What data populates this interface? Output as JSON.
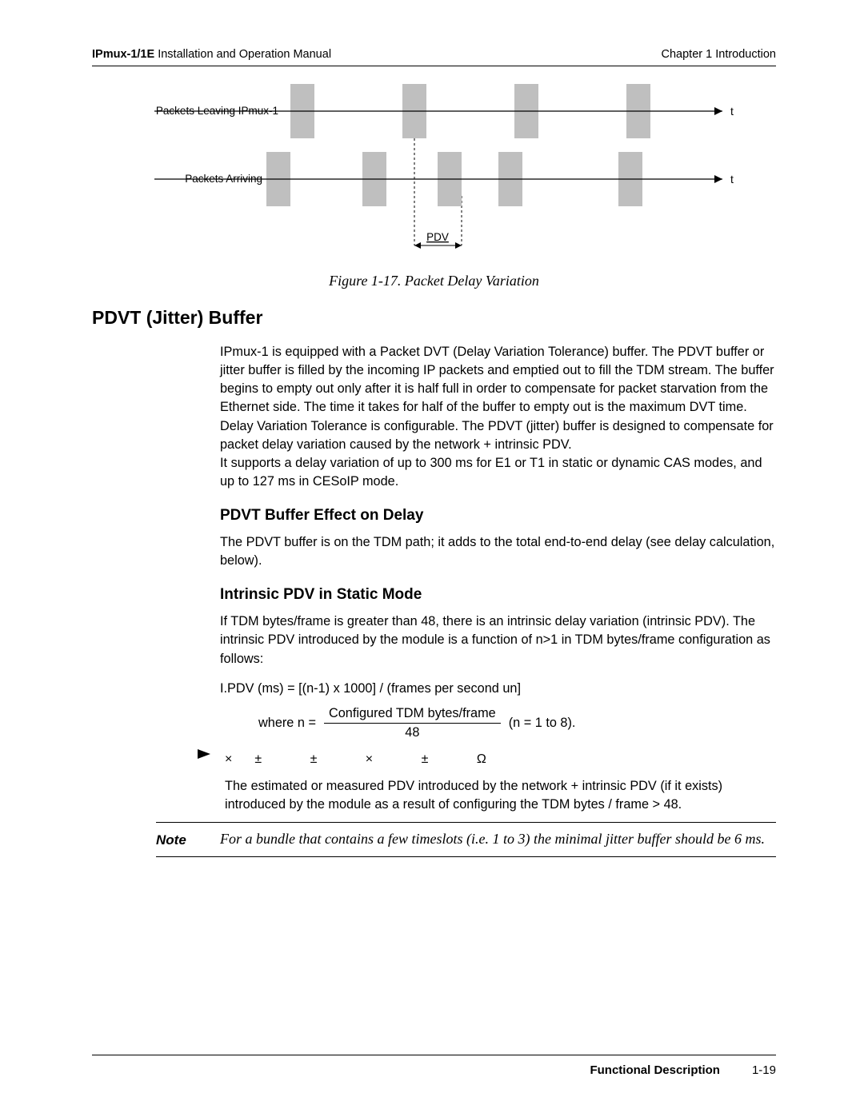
{
  "header": {
    "product": "IPmux-1/1E",
    "manual": " Installation and Operation Manual",
    "chapter": "Chapter 1  Introduction"
  },
  "figure": {
    "label_leaving": "Packets Leaving IPmux-1",
    "label_arriving": "Packets Arriving",
    "pdv_label": "PDV",
    "t1": "t",
    "t2": "t",
    "caption": "Figure 1-17.  Packet Delay Variation"
  },
  "h2": "PDVT (Jitter) Buffer",
  "para1": "IPmux-1 is equipped with a Packet DVT (Delay Variation Tolerance) buffer. The PDVT buffer or jitter buffer is filled by the incoming IP packets and emptied out to fill the TDM stream. The buffer begins to empty out only after it is half full in order to compensate for packet starvation from the Ethernet side. The time it takes for half of the buffer to empty out is the maximum DVT time. Delay Variation Tolerance is configurable. The PDVT (jitter) buffer is designed to compensate for packet delay variation caused by the network + intrinsic PDV.",
  "para1b": "It supports a delay variation of up to 300 ms for E1 or T1 in static or dynamic CAS modes, and up to 127 ms in CESoIP mode.",
  "h3a": "PDVT Buffer Effect on Delay",
  "para2": "The PDVT buffer is on the TDM path; it adds to the total end-to-end delay (see delay calculation, below).",
  "h3b": "Intrinsic PDV in Static Mode",
  "para3": "If TDM bytes/frame is greater than 48, there is an intrinsic delay variation (intrinsic PDV). The intrinsic PDV introduced by the module is a function of n>1 in TDM bytes/frame configuration as follows:",
  "formula": "I.PDV (ms) =  [(n-1) x 1000] / (frames per second  un]",
  "where": "where n =",
  "frac_num": "Configured TDM bytes/frame",
  "frac_den": "48",
  "n_range": "(n =  1 to 8).",
  "symbols": "×±      ±  ×   ±      Ω",
  "bullet_text": "The estimated or measured PDV introduced by the network + intrinsic PDV (if it exists) introduced by the module as a result of configuring the TDM bytes / frame >  48.",
  "note_label": "Note",
  "note_text": "For a bundle that contains a few timeslots (i.e. 1 to 3) the minimal jitter buffer should be 6 ms.",
  "footer": {
    "section": "Functional Description",
    "page": "1-19"
  }
}
